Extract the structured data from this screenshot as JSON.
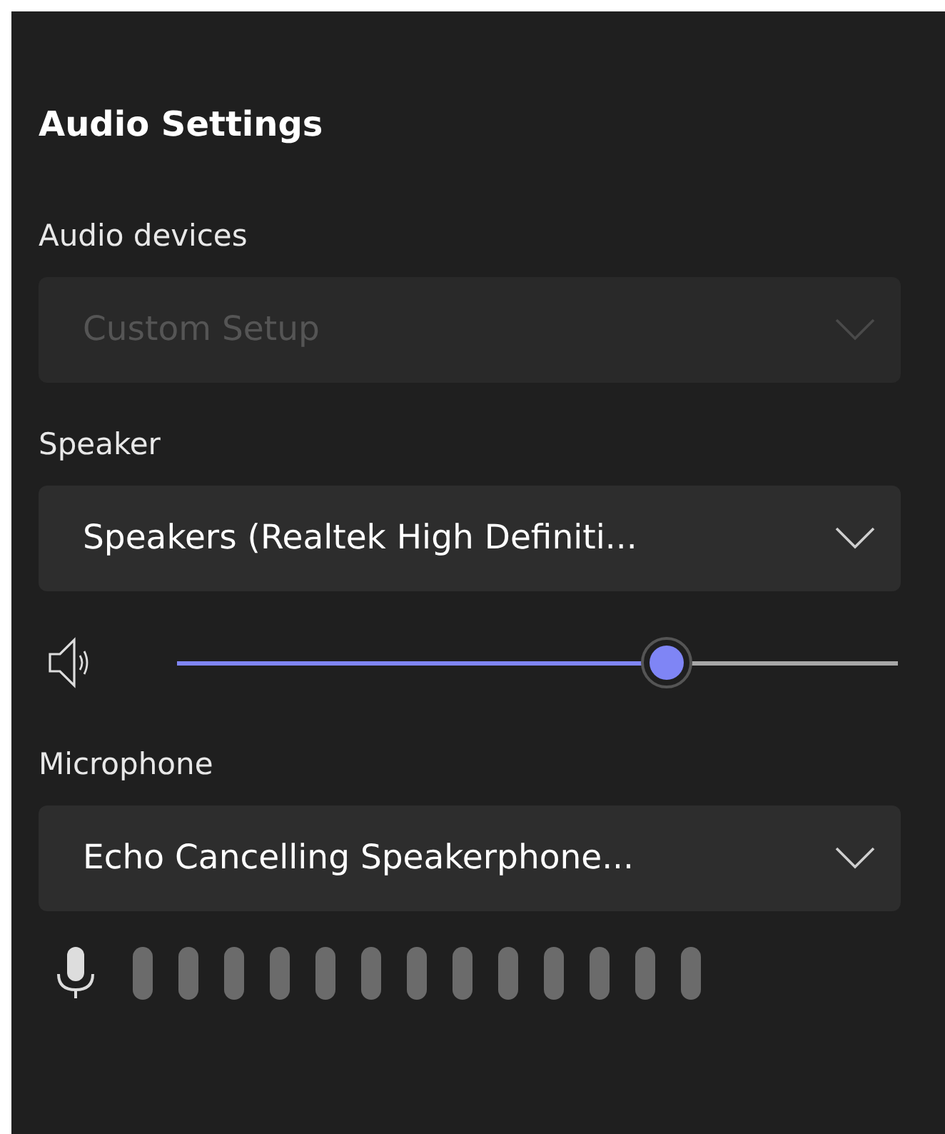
{
  "title": "Audio Settings",
  "sections": [
    {
      "kind": "dropdown",
      "label": "Audio devices",
      "value": "Custom Setup",
      "disabled": true
    },
    {
      "kind": "dropdown",
      "label": "Speaker",
      "value": "Speakers (Realtek High Definiti...",
      "disabled": false
    },
    {
      "kind": "slider",
      "level": 0.68
    },
    {
      "kind": "dropdown",
      "label": "Microphone",
      "value": "Echo Cancelling Speakerphone...",
      "disabled": false
    },
    {
      "kind": "meter"
    }
  ]
}
